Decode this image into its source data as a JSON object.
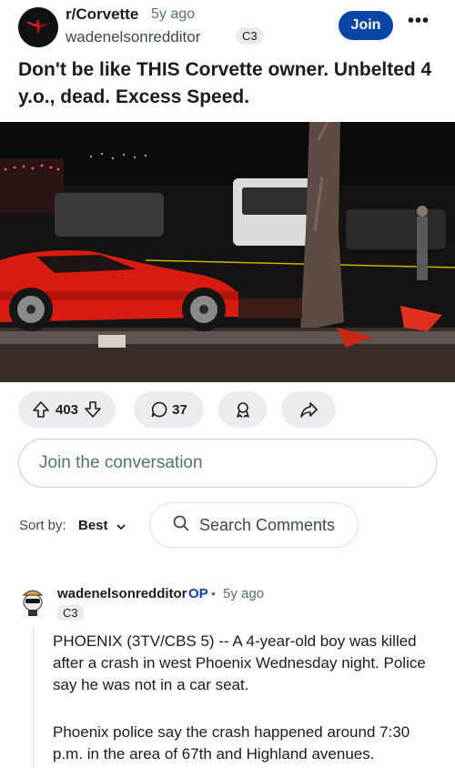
{
  "post": {
    "subreddit": "r/Corvette",
    "time_ago": "5y ago",
    "author": "wadenelsonredditor",
    "author_flair": "C3",
    "join_label": "Join",
    "more_label": "•••",
    "title": "Don't be like THIS Corvette owner. Unbelted 4 y.o., dead. Excess Speed."
  },
  "actions": {
    "score": "403",
    "comments": "37"
  },
  "composer": {
    "placeholder": "Join the conversation"
  },
  "sort": {
    "label": "Sort by:",
    "value": "Best",
    "search_placeholder": "Search Comments"
  },
  "comment": {
    "author": "wadenelsonredditor",
    "op_badge": "OP",
    "separator": "•",
    "time_ago": "5y ago",
    "flair": "C3",
    "paragraphs": [
      "PHOENIX (3TV/CBS 5) -- A 4-year-old boy was killed after a crash in west Phoenix Wednesday night. Police say he was not in a car seat.",
      "Phoenix police say the crash happened around 7:30 p.m. in the area of 67th and Highland avenues."
    ]
  },
  "colors": {
    "accent": "#0a45a6",
    "pill_bg": "#eaedef",
    "muted_text": "#576f76"
  },
  "icons": [
    "upvote-icon",
    "downvote-icon",
    "comment-icon",
    "award-icon",
    "share-icon",
    "search-icon",
    "chevron-down-icon"
  ]
}
